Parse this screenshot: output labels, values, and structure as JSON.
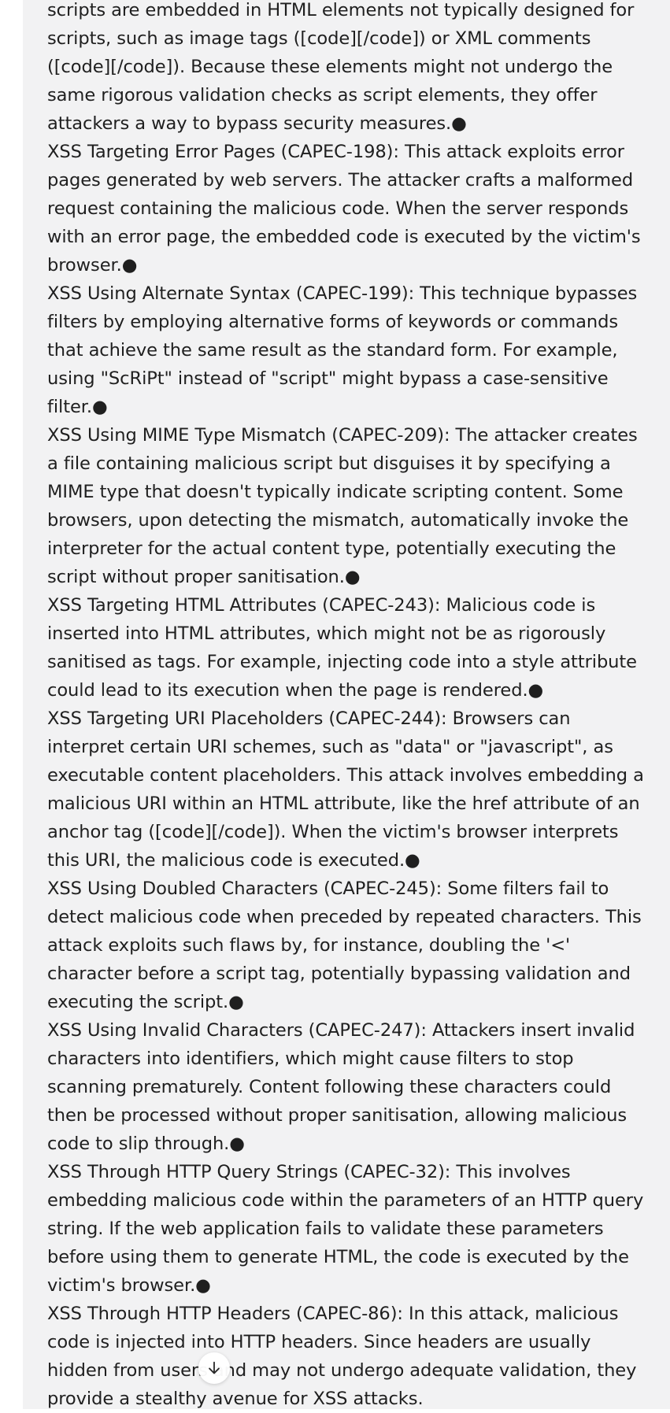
{
  "message": {
    "paragraphs": [
      "scripts are embedded in HTML elements not typically designed for scripts, such as image tags ([code][/code]) or XML comments ([code][/code]). Because these elements might not undergo the same rigorous validation checks as script elements, they offer attackers a way to bypass security measures.●",
      "XSS Targeting Error Pages (CAPEC-198): This attack exploits error pages generated by web servers. The attacker crafts a malformed request containing the malicious code. When the server responds with an error page, the embedded code is executed by the victim's browser.●",
      "XSS Using Alternate Syntax (CAPEC-199): This technique bypasses filters by employing alternative forms of keywords or commands that achieve the same result as the standard form. For example, using \"ScRiPt\" instead of \"script\" might bypass a case-sensitive filter.●",
      "XSS Using MIME Type Mismatch (CAPEC-209): The attacker creates a file containing malicious script but disguises it by specifying a MIME type that doesn't typically indicate scripting content. Some browsers, upon detecting the mismatch, automatically invoke the interpreter for the actual content type, potentially executing the script without proper sanitisation.●",
      "XSS Targeting HTML Attributes (CAPEC-243): Malicious code is inserted into HTML attributes, which might not be as rigorously sanitised as tags. For example, injecting code into a style attribute could lead to its execution when the page is rendered.●",
      "XSS Targeting URI Placeholders (CAPEC-244): Browsers can interpret certain URI schemes, such as \"data\" or \"javascript\", as executable content placeholders. This attack involves embedding a malicious URI within an HTML attribute, like the href attribute of an anchor tag ([code][/code]). When the victim's browser interprets this URI, the malicious code is executed.●",
      "XSS Using Doubled Characters (CAPEC-245): Some filters fail to detect malicious code when preceded by repeated characters. This attack exploits such flaws by, for instance, doubling the '<' character before a script tag, potentially bypassing validation and executing the script.●",
      "XSS Using Invalid Characters (CAPEC-247): Attackers insert invalid characters into identifiers, which might cause filters to stop scanning prematurely. Content following these characters could then be processed without proper sanitisation, allowing malicious code to slip through.●",
      "XSS Through HTTP Query Strings (CAPEC-32): This involves embedding malicious code within the parameters of an HTTP query string. If the web application fails to validate these parameters before using them to generate HTML, the code is executed by the victim's browser.●",
      "XSS Through HTTP Headers (CAPEC-86): In this attack, malicious code is injected into HTTP headers. Since headers are usually hidden from users and may not undergo adequate validation, they provide a stealthy avenue for XSS attacks."
    ]
  },
  "scroll_button": {
    "icon": "arrow-down-icon"
  }
}
